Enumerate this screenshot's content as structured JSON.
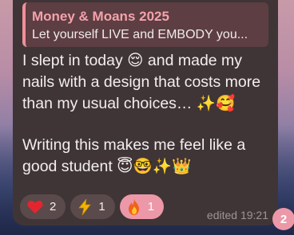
{
  "reply": {
    "title": "Money & Moans 2025",
    "text": "Let yourself LIVE and EMBODY you..."
  },
  "message": {
    "paragraph1": "I slept in today 😌 and made my nails with a design that costs more than my usual choices… ✨🥰",
    "paragraph2": "Writing this makes me feel like a good student 😇🤓✨👑"
  },
  "reactions": [
    {
      "emoji": "heart",
      "count": "2"
    },
    {
      "emoji": "lightning",
      "count": "1"
    },
    {
      "emoji": "fire",
      "count": "1"
    }
  ],
  "meta": {
    "edited": "edited 19:21"
  },
  "badge": {
    "unread_count": "2"
  },
  "colors": {
    "bubble": "#3f3536",
    "reply_accent": "#f08f9b",
    "active_reaction": "#ec98a8"
  }
}
